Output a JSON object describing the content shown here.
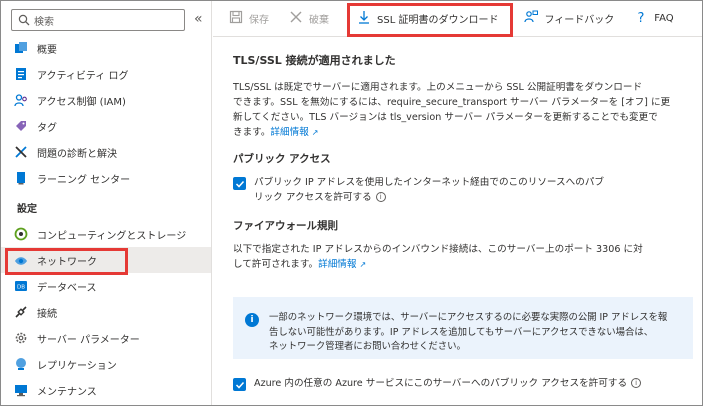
{
  "sidebar": {
    "search_placeholder": "検索",
    "collapse_glyph": "«",
    "items_top": [
      {
        "label": "概要",
        "icon": "overview-icon"
      },
      {
        "label": "アクティビティ ログ",
        "icon": "activity-log-icon"
      },
      {
        "label": "アクセス制御 (IAM)",
        "icon": "iam-icon"
      },
      {
        "label": "タグ",
        "icon": "tag-icon"
      },
      {
        "label": "問題の診断と解決",
        "icon": "diagnose-icon"
      },
      {
        "label": "ラーニング センター",
        "icon": "learning-center-icon"
      }
    ],
    "section_settings": "設定",
    "items_settings": [
      {
        "label": "コンピューティングとストレージ",
        "icon": "compute-storage-icon"
      },
      {
        "label": "ネットワーク",
        "icon": "network-icon"
      },
      {
        "label": "データベース",
        "icon": "database-icon"
      },
      {
        "label": "接続",
        "icon": "connect-icon"
      },
      {
        "label": "サーバー パラメーター",
        "icon": "server-params-icon"
      },
      {
        "label": "レプリケーション",
        "icon": "replication-icon"
      },
      {
        "label": "メンテナンス",
        "icon": "maintenance-icon"
      }
    ],
    "active_item": "ネットワーク"
  },
  "toolbar": {
    "save_label": "保存",
    "discard_label": "破棄",
    "download_ssl_label": "SSL 証明書のダウンロード",
    "feedback_label": "フィードバック",
    "faq_label": "FAQ"
  },
  "main": {
    "ssl_title": "TLS/SSL 接続が適用されました",
    "ssl_line1": "TLS/SSL は既定でサーバーに適用されます。上のメニューから SSL 公開証明書をダウンロード",
    "ssl_line2": "できます。SSL を無効にするには、require_secure_transport サーバー パラメーターを [オフ] に更",
    "ssl_line3": "新してください。TLS バージョンは tls_version サーバー パラメーターを更新することでも変更で",
    "ssl_line4_pre": "きます。",
    "learn_more": "詳細情報",
    "public_access_title": "パブリック アクセス",
    "public_access_line1": "パブリック IP アドレスを使用したインターネット経由でのこのリソースへのパブ",
    "public_access_line2": "リック アクセスを許可する",
    "firewall_title": "ファイアウォール規則",
    "firewall_line1": "以下で指定された IP アドレスからのインバウンド接続は、このサーバー上のポート 3306 に対",
    "firewall_line2_pre": "して許可されます。",
    "info_line1": "一部のネットワーク環境では、サーバーにアクセスするのに必要な実際の公開 IP アドレスを報",
    "info_line2": "告しない可能性があります。IP アドレスを追加してもサーバーにアクセスできない場合は、",
    "info_line3": "ネットワーク管理者にお問い合わせください。",
    "azure_access_label": "Azure 内の任意の Azure サービスにこのサーバーへのパブリック アクセスを許可する"
  },
  "colors": {
    "accent": "#0078d4",
    "highlight": "#e53935",
    "info_bg": "#ebf3fc"
  }
}
